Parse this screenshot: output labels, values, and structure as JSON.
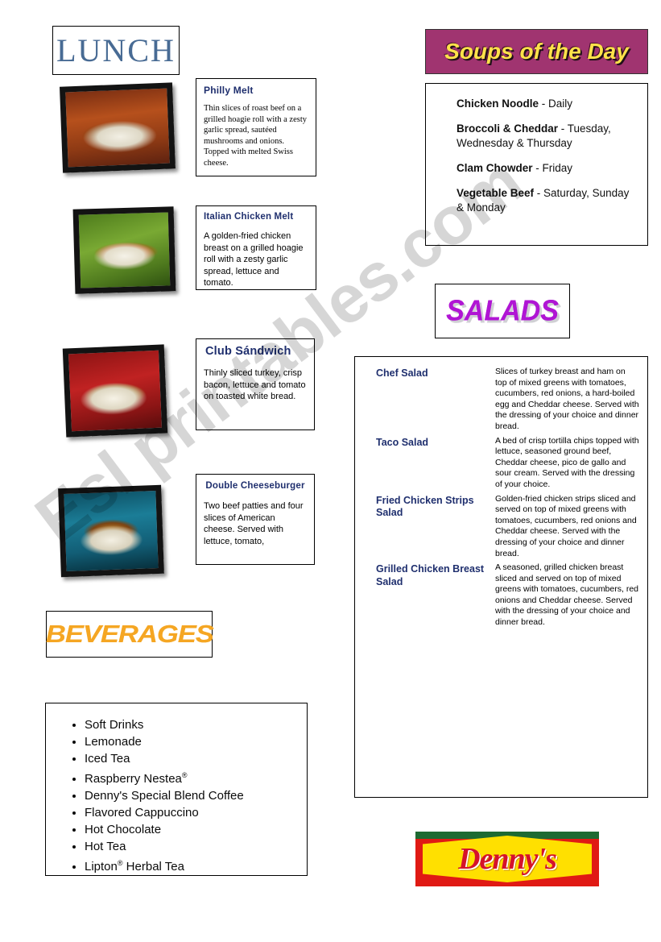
{
  "watermark": {
    "text": "Esl printables.com"
  },
  "lunch": {
    "header_label": "LUNCH",
    "items": [
      {
        "name": "Philly Melt",
        "description": "Thin slices of roast beef on a grilled hoagie roll with a zesty garlic spread, sautéed mushrooms and onions. Topped with melted Swiss cheese.",
        "photo_alt": "philly-melt-photo"
      },
      {
        "name": "Italian Chicken Melt",
        "description": "A golden-fried chicken breast on a grilled hoagie roll with a zesty garlic spread, lettuce and tomato.",
        "photo_alt": "italian-chicken-melt-photo"
      },
      {
        "name": "Club Sándwich",
        "description": "Thinly sliced turkey, crisp bacon, lettuce and tomato on toasted white bread.",
        "photo_alt": "club-sandwich-photo"
      },
      {
        "name": "Double Cheeseburger",
        "description": "Two beef patties and four slices of American cheese.  Served with lettuce, tomato,",
        "photo_alt": "double-cheeseburger-photo"
      }
    ]
  },
  "soups": {
    "header_label": "Soups of the Day",
    "header_bg": "#a03470",
    "header_color": "#ffe24a",
    "items": [
      {
        "name": "Chicken Noodle",
        "days": " - Daily"
      },
      {
        "name": "Broccoli & Cheddar",
        "days": " - Tuesday, Wednesday & Thursday"
      },
      {
        "name": "Clam Chowder",
        "days": " - Friday"
      },
      {
        "name": "Vegetable Beef",
        "days": " - Saturday, Sunday & Monday"
      }
    ]
  },
  "salads": {
    "header_label": "SALADS",
    "header_color": "#b015d4",
    "items": [
      {
        "name": "Chef Salad",
        "description": "Slices of turkey breast and ham on top of mixed greens with tomatoes, cucumbers, red onions, a hard-boiled egg and Cheddar cheese.  Served with the dressing of your choice and dinner bread."
      },
      {
        "name": "Taco Salad",
        "description": "A bed of crisp tortilla chips topped with lettuce, seasoned ground beef, Cheddar cheese, pico de gallo and sour cream. Served with the dressing of your choice."
      },
      {
        "name": "Fried Chicken Strips Salad",
        "description": "Golden-fried chicken strips sliced and served on top of mixed greens with tomatoes, cucumbers, red onions and Cheddar cheese. Served with the dressing of your choice and dinner bread."
      },
      {
        "name": "Grilled Chicken Breast Salad",
        "description": "A seasoned, grilled chicken breast sliced and served on top of mixed greens with tomatoes, cucumbers, red onions and Cheddar cheese. Served with the dressing of your choice and dinner bread."
      }
    ]
  },
  "beverages": {
    "header_label": "BEVERAGES",
    "header_color": "#f5a623",
    "items": [
      {
        "text": "Soft Drinks",
        "sup": ""
      },
      {
        "text": "Lemonade",
        "sup": ""
      },
      {
        "text": "Iced Tea",
        "sup": ""
      },
      {
        "text": "Raspberry Nestea",
        "sup": "®"
      },
      {
        "text": "Denny's Special Blend Coffee",
        "sup": ""
      },
      {
        "text": "Flavored Cappuccino",
        "sup": ""
      },
      {
        "text": "Hot Chocolate",
        "sup": ""
      },
      {
        "text": "Hot Tea",
        "sup": ""
      },
      {
        "text": "Lipton",
        "sup": "®",
        "suffix": " Herbal Tea"
      }
    ]
  },
  "brand": {
    "logo_text": "Denny's",
    "logo_red": "#e01a14",
    "logo_yellow": "#ffe000",
    "logo_green": "#1d6a32"
  }
}
